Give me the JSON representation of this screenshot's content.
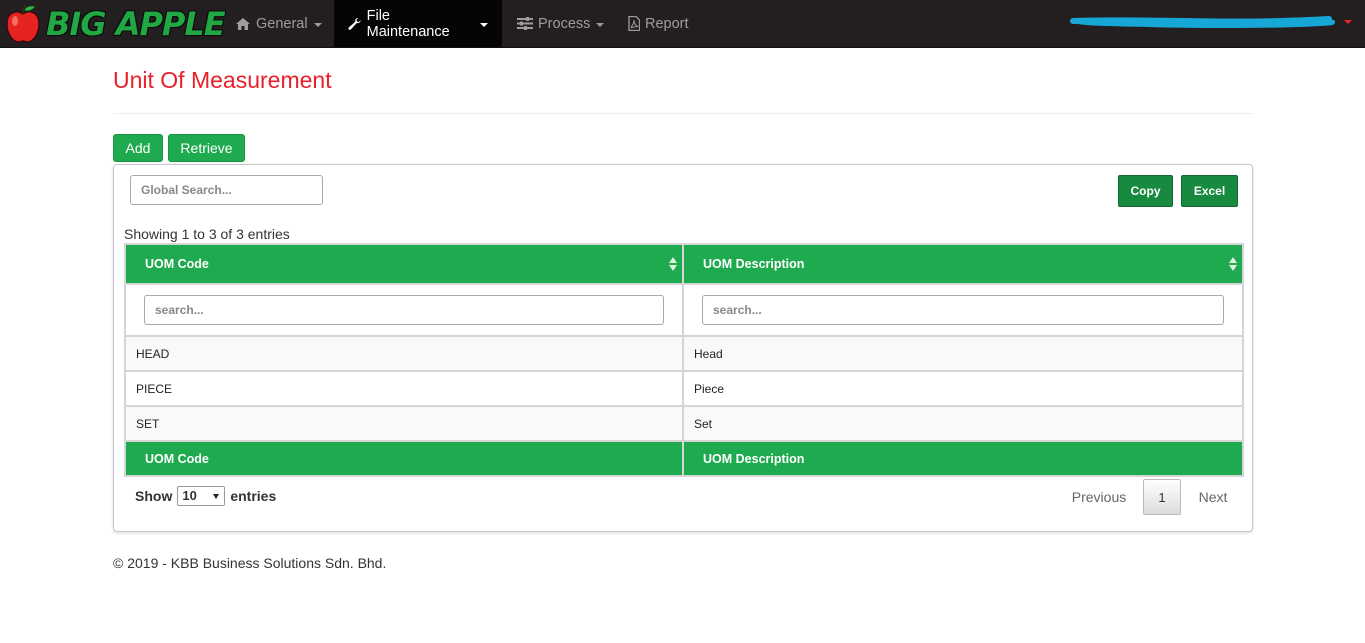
{
  "nav": {
    "brand": "BIG APPLE",
    "items": [
      {
        "label": "General",
        "icon": "home-icon",
        "dropdown": true
      },
      {
        "label": "File Maintenance",
        "icon": "wrench-icon",
        "dropdown": true,
        "active": true
      },
      {
        "label": "Process",
        "icon": "sliders-icon",
        "dropdown": true
      },
      {
        "label": "Report",
        "icon": "pdf-file-icon",
        "dropdown": false
      }
    ]
  },
  "page": {
    "title": "Unit Of Measurement"
  },
  "actions": {
    "add": "Add",
    "retrieve": "Retrieve"
  },
  "toolbar": {
    "global_search_placeholder": "Global Search...",
    "copy": "Copy",
    "excel": "Excel"
  },
  "table": {
    "info": "Showing 1 to 3 of 3 entries",
    "columns": [
      "UOM Code",
      "UOM Description"
    ],
    "column_search_placeholder": "search...",
    "rows": [
      [
        "HEAD",
        "Head"
      ],
      [
        "PIECE",
        "Piece"
      ],
      [
        "SET",
        "Set"
      ]
    ],
    "footer": [
      "UOM Code",
      "UOM Description"
    ]
  },
  "length": {
    "show": "Show",
    "value": "10",
    "entries": "entries"
  },
  "pagination": {
    "previous": "Previous",
    "current": "1",
    "next": "Next"
  },
  "footer": {
    "text": "© 2019 - KBB Business Solutions Sdn. Bhd."
  },
  "colors": {
    "green": "#1faa4f",
    "dark_green": "#178a3f",
    "title_red": "#e8202a",
    "navbar": "#231f20"
  }
}
